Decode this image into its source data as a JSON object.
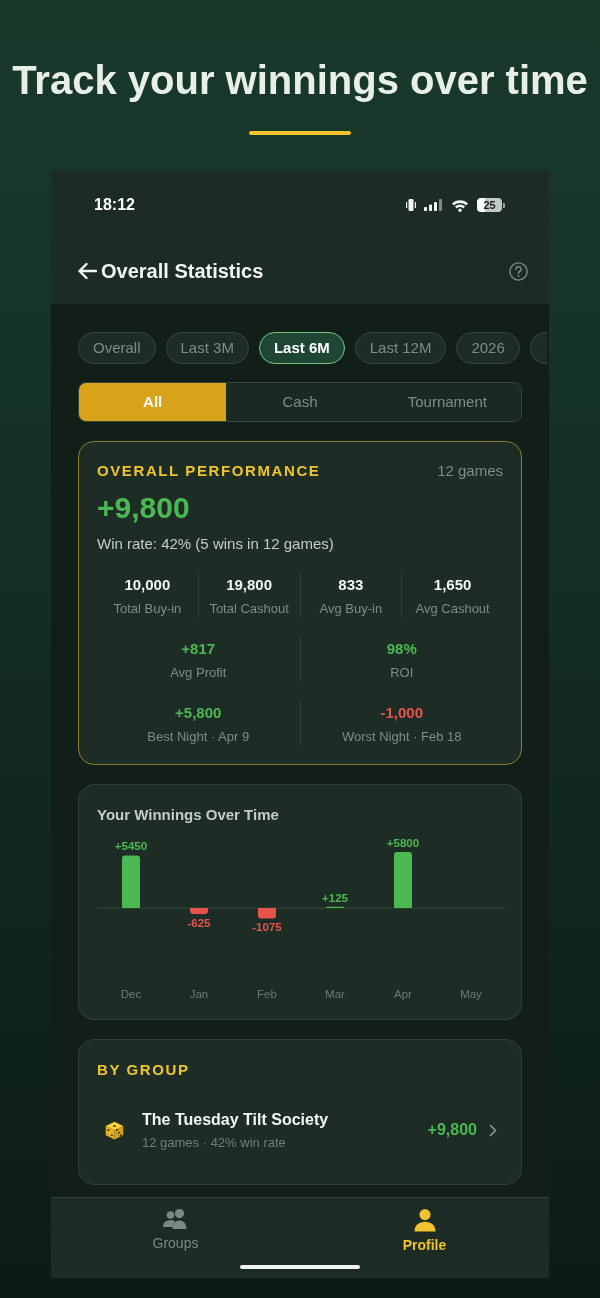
{
  "headline": {
    "title": "Track your winnings over time"
  },
  "status_bar": {
    "time": "18:12",
    "battery": "25"
  },
  "app_bar": {
    "title": "Overall Statistics"
  },
  "period_chips": [
    {
      "label": "Overall",
      "selected": false
    },
    {
      "label": "Last 3M",
      "selected": false
    },
    {
      "label": "Last 6M",
      "selected": true
    },
    {
      "label": "Last 12M",
      "selected": false
    },
    {
      "label": "2026",
      "selected": false
    }
  ],
  "period_chips_overflow": true,
  "type_segments": [
    {
      "label": "All",
      "selected": true
    },
    {
      "label": "Cash",
      "selected": false
    },
    {
      "label": "Tournament",
      "selected": false
    }
  ],
  "performance": {
    "title": "OVERALL PERFORMANCE",
    "games": "12 games",
    "total": "+9,800",
    "win_rate": "Win rate: 42% (5 wins in 12 games)",
    "stats": [
      {
        "value": "10,000",
        "label": "Total Buy-in"
      },
      {
        "value": "19,800",
        "label": "Total Cashout"
      },
      {
        "value": "833",
        "label": "Avg Buy-in"
      },
      {
        "value": "1,650",
        "label": "Avg Cashout"
      }
    ],
    "highlights": [
      {
        "value": "+817",
        "label": "Avg Profit",
        "color": "#4cb852"
      },
      {
        "value": "98%",
        "label": "ROI",
        "color": "#4cb852"
      },
      {
        "value": "+5,800",
        "label": "Best Night · Apr 9",
        "color": "#4cb852"
      },
      {
        "value": "-1,000",
        "label": "Worst Night · Feb 18",
        "color": "#e5534b"
      }
    ]
  },
  "winnings_chart": {
    "chart_data": {
      "type": "bar",
      "title": "Your Winnings Over Time",
      "categories": [
        "Dec",
        "Jan",
        "Feb",
        "Mar",
        "Apr",
        "May"
      ],
      "values": [
        5450,
        -625,
        -1075,
        125,
        5800,
        null
      ],
      "value_labels": [
        "+5450",
        "-625",
        "-1075",
        "+125",
        "+5800",
        null
      ]
    }
  },
  "by_group": {
    "title": "BY GROUP",
    "groups": [
      {
        "name": "The Tuesday Tilt Society",
        "details": "12 games · 42% win rate",
        "total": "+9,800"
      }
    ]
  },
  "bottom_nav": [
    {
      "label": "Groups",
      "kind": "groups",
      "selected": false
    },
    {
      "label": "Profile",
      "kind": "profile",
      "selected": true
    }
  ]
}
